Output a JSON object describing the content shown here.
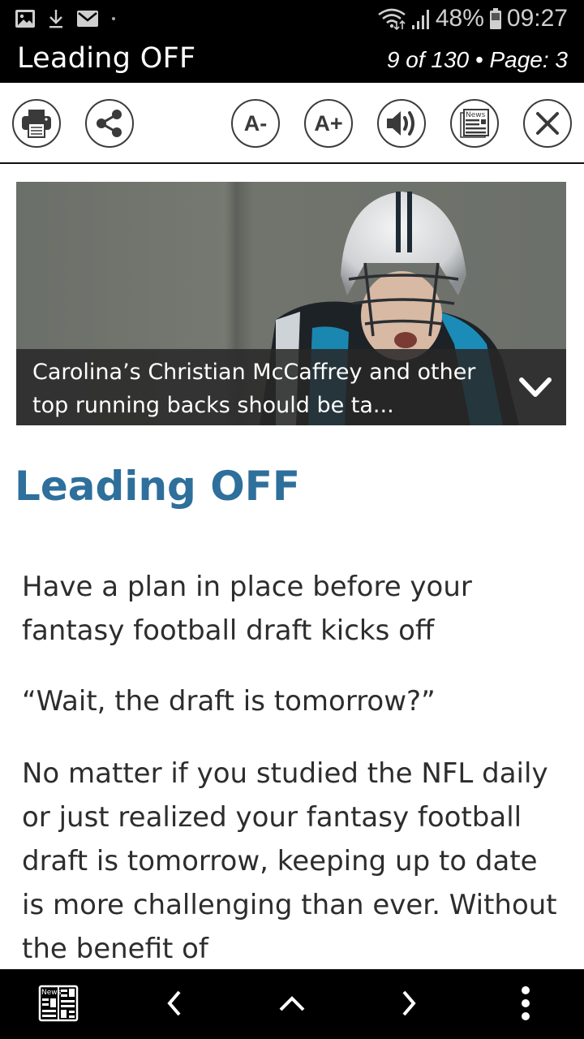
{
  "status_bar": {
    "notification_icons": [
      "image-icon",
      "download-icon",
      "email-icon",
      "dot-icon"
    ],
    "battery_percent": "48%",
    "time": "09:27"
  },
  "title_bar": {
    "title": "Leading OFF",
    "page_info": "9 of 130 • Page: 3"
  },
  "toolbar": {
    "buttons": [
      {
        "name": "print",
        "icon": "printer-icon"
      },
      {
        "name": "share",
        "icon": "share-icon"
      },
      {
        "name": "decrease-font",
        "label": "A-"
      },
      {
        "name": "increase-font",
        "label": "A+"
      },
      {
        "name": "read-aloud",
        "icon": "speaker-icon"
      },
      {
        "name": "newspaper-view",
        "icon": "newspaper-icon",
        "label": "News"
      },
      {
        "name": "close",
        "icon": "close-icon"
      }
    ]
  },
  "hero": {
    "caption": "Carolina’s Christian McCaffrey and other top running backs should be ta..."
  },
  "article": {
    "title": "Leading OFF",
    "subtitle": "Have a plan in place before your fantasy football draft kicks off",
    "paragraphs": [
      "“Wait, the draft is tomorrow?”",
      "No matter if you studied the NFL daily or just realized your fantasy football draft is tomorrow, keeping up to date is more challenging than ever. Without the benefit of"
    ]
  },
  "bottom_bar": {
    "buttons": [
      "pages-view",
      "previous",
      "up",
      "next",
      "more"
    ],
    "pages_icon_label": "News"
  },
  "colors": {
    "accent_title": "#2e6f9b",
    "bar_background": "#000000",
    "body_text": "#2d2d2d",
    "icon_stroke": "#3c3c3c"
  }
}
